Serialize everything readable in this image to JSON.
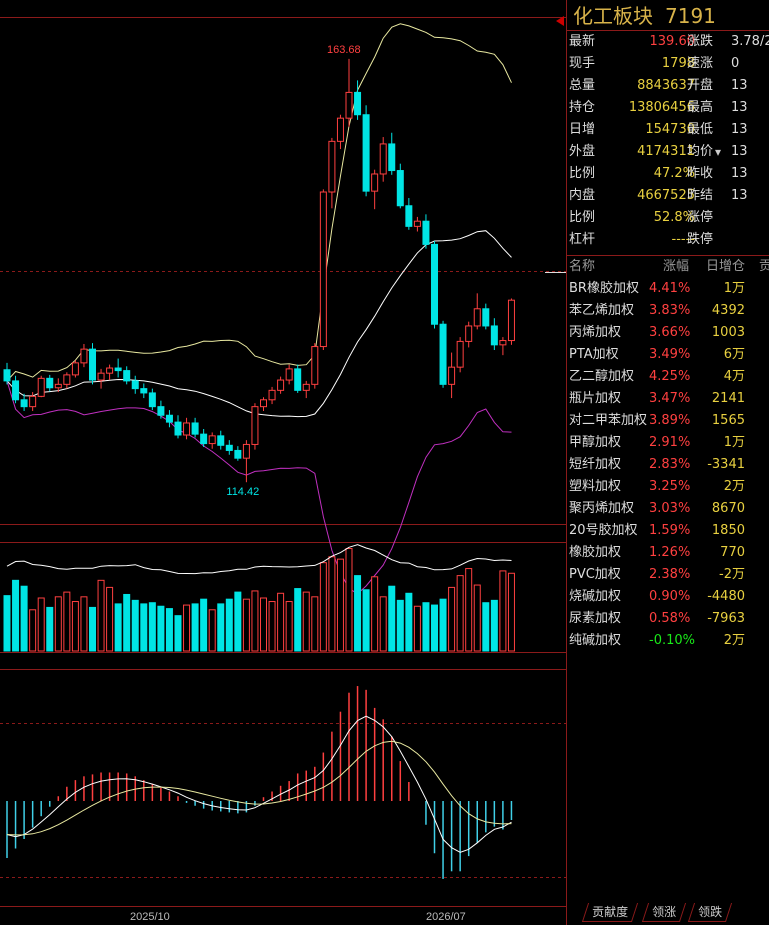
{
  "panel": {
    "title": "化工板块",
    "code": "7191",
    "quote_rows": [
      {
        "l1": "最新",
        "v1": "139.60",
        "c1": "red",
        "l2": "涨跌",
        "v2": "3.78/2",
        "c2": "red"
      },
      {
        "l1": "现手",
        "v1": "1798",
        "c1": "yel",
        "l2": "速涨",
        "v2": "0",
        "c2": "red"
      },
      {
        "l1": "总量",
        "v1": "8843637",
        "c1": "yel",
        "l2": "开盘",
        "v2": "13",
        "c2": "red"
      },
      {
        "l1": "持仓",
        "v1": "13806456",
        "c1": "yel",
        "l2": "最高",
        "v2": "13",
        "c2": "red"
      },
      {
        "l1": "日增",
        "v1": "154730",
        "c1": "yel",
        "l2": "最低",
        "v2": "13",
        "c2": "red"
      },
      {
        "l1": "外盘",
        "v1": "4174311",
        "c1": "yel",
        "l2": "均价",
        "v2": "13",
        "c2": "red"
      },
      {
        "l1": "比例",
        "v1": "47.2%",
        "c1": "yel",
        "l2": "昨收",
        "v2": "13",
        "c2": ""
      },
      {
        "l1": "内盘",
        "v1": "4667525",
        "c1": "yel",
        "l2": "昨结",
        "v2": "13",
        "c2": ""
      },
      {
        "l1": "比例",
        "v1": "52.8%",
        "c1": "yel",
        "l2": "涨停",
        "v2": "",
        "c2": ""
      },
      {
        "l1": "杠杆",
        "v1": "-----",
        "c1": "yel",
        "l2": "跌停",
        "v2": "",
        "c2": ""
      }
    ],
    "list_headers": {
      "name": "名称",
      "change": "涨幅",
      "daily": "日增仓",
      "extra": "贡"
    },
    "list": [
      {
        "name": "BR橡胶加权",
        "change": "4.41%",
        "cls": "red",
        "daily": "1万"
      },
      {
        "name": "苯乙烯加权",
        "change": "3.83%",
        "cls": "red",
        "daily": "4392"
      },
      {
        "name": "丙烯加权",
        "change": "3.66%",
        "cls": "red",
        "daily": "1003"
      },
      {
        "name": "PTA加权",
        "change": "3.49%",
        "cls": "red",
        "daily": "6万"
      },
      {
        "name": "乙二醇加权",
        "change": "4.25%",
        "cls": "red",
        "daily": "4万"
      },
      {
        "name": "瓶片加权",
        "change": "3.47%",
        "cls": "red",
        "daily": "2141"
      },
      {
        "name": "对二甲苯加权",
        "change": "3.89%",
        "cls": "red",
        "daily": "1565"
      },
      {
        "name": "甲醇加权",
        "change": "2.91%",
        "cls": "red",
        "daily": "1万"
      },
      {
        "name": "短纤加权",
        "change": "2.83%",
        "cls": "red",
        "daily": "-3341"
      },
      {
        "name": "塑料加权",
        "change": "3.25%",
        "cls": "red",
        "daily": "2万"
      },
      {
        "name": "聚丙烯加权",
        "change": "3.03%",
        "cls": "red",
        "daily": "8670"
      },
      {
        "name": "20号胶加权",
        "change": "1.59%",
        "cls": "red",
        "daily": "1850"
      },
      {
        "name": "橡胶加权",
        "change": "1.26%",
        "cls": "red",
        "daily": "770"
      },
      {
        "name": "PVC加权",
        "change": "2.38%",
        "cls": "red",
        "daily": "-2万"
      },
      {
        "name": "烧碱加权",
        "change": "0.90%",
        "cls": "red",
        "daily": "-4480"
      },
      {
        "name": "尿素加权",
        "change": "0.58%",
        "cls": "red",
        "daily": "-7963"
      },
      {
        "name": "纯碱加权",
        "change": "-0.10%",
        "cls": "grn",
        "daily": "2万"
      }
    ],
    "tabs": [
      "贡献度",
      "领涨",
      "领跌"
    ]
  },
  "chart_data": {
    "type": "candlestick",
    "price_high_label": "163.68",
    "price_low_label": "114.42",
    "x_labels": [
      "2025/10",
      "2026/07"
    ],
    "price_range": [
      110,
      168
    ],
    "reference_price": 135.5,
    "colors": {
      "up": "#ff4040",
      "down": "#00e5e5",
      "ma": "#e8e8a0",
      "boll_low": "#c030c0",
      "volline": "#ffffff",
      "macd_pos": "#ff4040",
      "macd_neg": "#40d0e8"
    },
    "candles": [
      [
        127.5,
        128.3,
        125.8,
        126.2
      ],
      [
        126.2,
        126.8,
        123.6,
        124
      ],
      [
        124,
        124.7,
        122.7,
        123.2
      ],
      [
        123.2,
        124.9,
        122.7,
        124.4
      ],
      [
        124.4,
        126.8,
        124.3,
        126.5
      ],
      [
        126.5,
        126.9,
        125,
        125.4
      ],
      [
        125.4,
        126.5,
        124.9,
        125.8
      ],
      [
        125.8,
        127.2,
        125.3,
        126.9
      ],
      [
        126.9,
        128.6,
        126.6,
        128.3
      ],
      [
        128.3,
        130.5,
        127.8,
        129.9
      ],
      [
        129.9,
        130.6,
        125.8,
        126.3
      ],
      [
        126.3,
        127.6,
        125.3,
        127.1
      ],
      [
        127.1,
        128.1,
        126.3,
        127.7
      ],
      [
        127.7,
        128.8,
        126.6,
        127.4
      ],
      [
        127.4,
        127.9,
        125.8,
        126.2
      ],
      [
        126.2,
        126.8,
        124.7,
        125.3
      ],
      [
        125.3,
        125.9,
        124.2,
        124.8
      ],
      [
        124.8,
        125.3,
        122.8,
        123.2
      ],
      [
        123.2,
        123.9,
        121.8,
        122.2
      ],
      [
        122.2,
        122.8,
        120.8,
        121.4
      ],
      [
        121.4,
        122.2,
        119.5,
        119.9
      ],
      [
        119.9,
        121.9,
        119.4,
        121.3
      ],
      [
        121.3,
        121.9,
        119.6,
        120
      ],
      [
        120,
        120.6,
        118.5,
        118.9
      ],
      [
        118.9,
        120.2,
        118.3,
        119.8
      ],
      [
        119.8,
        120.4,
        118.2,
        118.7
      ],
      [
        118.7,
        119.3,
        117.6,
        118.1
      ],
      [
        118.1,
        118.6,
        116.9,
        117.2
      ],
      [
        117.2,
        119.3,
        114.4,
        118.8
      ],
      [
        118.8,
        123.6,
        118.2,
        123.2
      ],
      [
        123.2,
        124.3,
        122.7,
        124
      ],
      [
        124,
        125.5,
        123.5,
        125.1
      ],
      [
        125.1,
        126.7,
        124.7,
        126.3
      ],
      [
        126.3,
        128.1,
        125.8,
        127.6
      ],
      [
        127.6,
        128.1,
        124.8,
        125.1
      ],
      [
        125.1,
        126.2,
        124.2,
        125.8
      ],
      [
        125.8,
        130.6,
        125.3,
        130.2
      ],
      [
        130.2,
        148.5,
        129.8,
        148.2
      ],
      [
        148.2,
        154.5,
        146.3,
        154.1
      ],
      [
        154.1,
        157.2,
        153.2,
        156.8
      ],
      [
        156.8,
        163.7,
        155.8,
        159.8
      ],
      [
        159.8,
        161.2,
        156.6,
        157.2
      ],
      [
        157.2,
        158.3,
        147.7,
        148.3
      ],
      [
        148.3,
        150.8,
        146.2,
        150.3
      ],
      [
        150.3,
        154.6,
        149.4,
        153.8
      ],
      [
        153.8,
        155.1,
        150.2,
        150.7
      ],
      [
        150.7,
        151.5,
        146.3,
        146.6
      ],
      [
        146.6,
        147.5,
        143.8,
        144.2
      ],
      [
        144.2,
        145.3,
        143.6,
        144.8
      ],
      [
        144.8,
        145.6,
        141.6,
        142.1
      ],
      [
        142.1,
        142.5,
        132.3,
        132.8
      ],
      [
        132.8,
        133.2,
        125.4,
        125.8
      ],
      [
        125.8,
        129.5,
        124.2,
        127.8
      ],
      [
        127.8,
        131.3,
        127.2,
        130.8
      ],
      [
        130.8,
        133.1,
        130.1,
        132.6
      ],
      [
        132.6,
        136.4,
        132.2,
        134.6
      ],
      [
        134.6,
        135.2,
        132.2,
        132.6
      ],
      [
        132.6,
        133.5,
        129.8,
        130.4
      ],
      [
        130.4,
        131.3,
        129.2,
        130.9
      ],
      [
        130.9,
        135.8,
        130.4,
        135.6
      ]
    ],
    "volumes": [
      47,
      60,
      55,
      35,
      45,
      37,
      46,
      50,
      42,
      46,
      37,
      60,
      54,
      40,
      48,
      43,
      40,
      41,
      38,
      36,
      30,
      39,
      40,
      44,
      35,
      40,
      44,
      50,
      44,
      51,
      45,
      42,
      49,
      42,
      53,
      50,
      46,
      75,
      80,
      78,
      87,
      64,
      52,
      63,
      46,
      55,
      43,
      49,
      38,
      41,
      39,
      44,
      54,
      64,
      70,
      56,
      41,
      43,
      68,
      66
    ],
    "macd": [
      -6,
      -5,
      -4,
      -2.8,
      -1.6,
      -0.6,
      0.5,
      1.5,
      2.2,
      2.6,
      2.8,
      3,
      3,
      3,
      2.9,
      2.6,
      2.2,
      1.8,
      1.4,
      1,
      0.5,
      -0.2,
      -0.5,
      -0.8,
      -1,
      -1.1,
      -1.2,
      -1.3,
      -1.2,
      -0.5,
      0.4,
      1,
      1.6,
      2.1,
      2.9,
      3.2,
      3.6,
      5.1,
      7.3,
      9.4,
      11.4,
      12.1,
      11.7,
      9.8,
      8.6,
      6.8,
      4.2,
      2,
      0,
      -2.5,
      -5.5,
      -8.2,
      -7.4,
      -7.4,
      -5.8,
      -4.4,
      -3.3,
      -2.7,
      -3,
      -2
    ]
  }
}
